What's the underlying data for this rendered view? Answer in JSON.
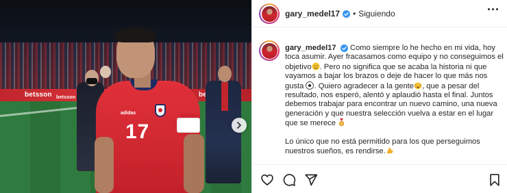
{
  "post": {
    "username": "gary_medel17",
    "follow_status": "Siguiendo",
    "separator": "•"
  },
  "media": {
    "ad_text_1": "betsson",
    "ad_text_2": "betsson",
    "ad_text_3": "betsson",
    "jersey_number": "17",
    "jersey_brand": "adidas"
  },
  "caption": {
    "username": "gary_medel17",
    "p1_a": "Como siempre lo he hecho en mi vida, hoy toca asumir. Ayer fracasamos como equipo y no conseguimos el objetivo",
    "p1_b": ". Pero no significa que se acaba la historia ni que vayamos a bajar los brazos o deje de hacer lo que más nos gusta",
    "p1_c": ". Quiero agradecer a la gente",
    "p1_d": ", que a pesar del resultado, nos esperó, alentó y aplaudió hasta el final. Juntos debemos trabajar para encontrar un nuevo camino, una nueva generación y que nuestra selección vuelva a estar en el lugar que se merece",
    "p2": "Lo único que no está permitido para los que perseguimos nuestros sueños, es rendirse."
  },
  "icons": {
    "verified": "verified-badge-icon",
    "more": "more-options-icon",
    "next": "chevron-right-icon",
    "like": "heart-icon",
    "comment": "comment-icon",
    "share": "paper-plane-icon",
    "save": "bookmark-icon"
  },
  "colors": {
    "verified": "#3897f0",
    "text": "#262626",
    "border": "#efefef"
  }
}
